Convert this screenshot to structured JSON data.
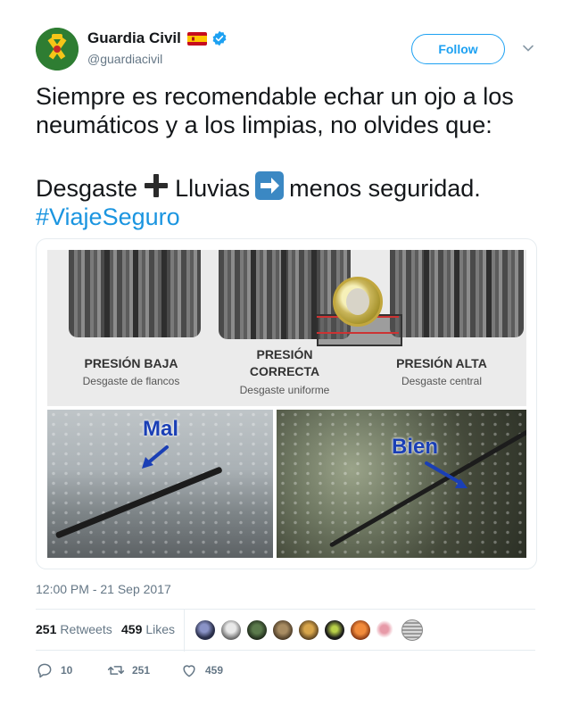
{
  "author": {
    "name": "Guardia Civil",
    "handle": "@guardiacivil",
    "flag_icon": "spain-flag-icon",
    "verified_icon": "verified-badge-icon"
  },
  "follow_label": "Follow",
  "tweet": {
    "line1": "Siempre es recomendable echar un ojo a los neumáticos y a los limpias, no olvides que:",
    "word_desgaste": "Desgaste",
    "word_lluvias": "Lluvias",
    "word_menos": "menos seguridad.",
    "hashtag": "#ViajeSeguro"
  },
  "media": {
    "tires": [
      {
        "label_line1": "PRESIÓN BAJA",
        "label_line2": "",
        "sub": "Desgaste de flancos"
      },
      {
        "label_line1": "PRESIÓN",
        "label_line2": "CORRECTA",
        "sub": "Desgaste uniforme"
      },
      {
        "label_line1": "PRESIÓN ALTA",
        "label_line2": "",
        "sub": "Desgaste central"
      }
    ],
    "wiper_bad": "Mal",
    "wiper_good": "Bien"
  },
  "timestamp": "12:00 PM - 21 Sep 2017",
  "stats": {
    "retweets_count": "251",
    "retweets_label": "Retweets",
    "likes_count": "459",
    "likes_label": "Likes"
  },
  "actions": {
    "reply_count": "10",
    "retweet_count": "251",
    "like_count": "459"
  },
  "colors": {
    "accent": "#1da1f2",
    "hashtag": "#1b95e0",
    "muted": "#657786"
  }
}
